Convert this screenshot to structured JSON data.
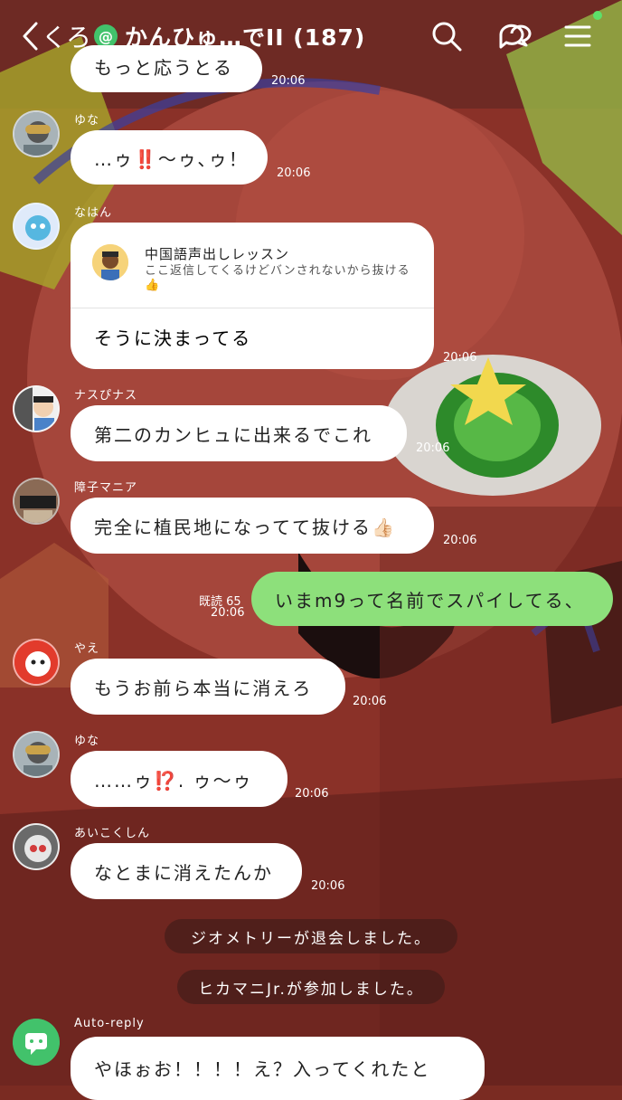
{
  "header": {
    "back_label": "くろ",
    "group_badge": "@",
    "title": "かんひゅ…でII (187)"
  },
  "messages": [
    {
      "partial_text": "もっと応うとる",
      "time": "20:06"
    },
    {
      "sender": "ゆな",
      "text_a": "…ゥ",
      "emoji": "‼️",
      "text_b": "〜ゥ､ゥ！",
      "time": "20:06"
    },
    {
      "sender": "なはん",
      "reply_to_name": "中国語声出しレッスン",
      "reply_to_text": "ここ返信してくるけどバンされないから抜ける👍",
      "text": "そうに決まってる",
      "time": "20:06"
    },
    {
      "sender": "ナスぴナス",
      "text": "第二のカンヒュに出来るでこれ",
      "time": "20:06"
    },
    {
      "sender": "障子マニア",
      "text": "完全に植民地になってて抜ける👍🏻",
      "time": "20:06"
    },
    {
      "read_label": "既読 65",
      "time": "20:06",
      "text": "いまm9って名前でスパイしてる、"
    },
    {
      "sender": "やえ",
      "text": "もうお前ら本当に消えろ",
      "time": "20:06"
    },
    {
      "sender": "ゆな",
      "text_a": "……ゥ",
      "emoji": "⁉️",
      "text_b": ". ゥ〜ゥ",
      "time": "20:06"
    },
    {
      "sender": "あいこくしん",
      "text": "なとまに消えたんか",
      "time": "20:06"
    }
  ],
  "system": [
    {
      "text": "ジオメトリーが退会しました。"
    },
    {
      "text": "ヒカマニJr.が参加しました。"
    }
  ],
  "autoreply": {
    "sender": "Auto-reply",
    "text": "やほぉお！！！！え？入ってくれたと"
  }
}
